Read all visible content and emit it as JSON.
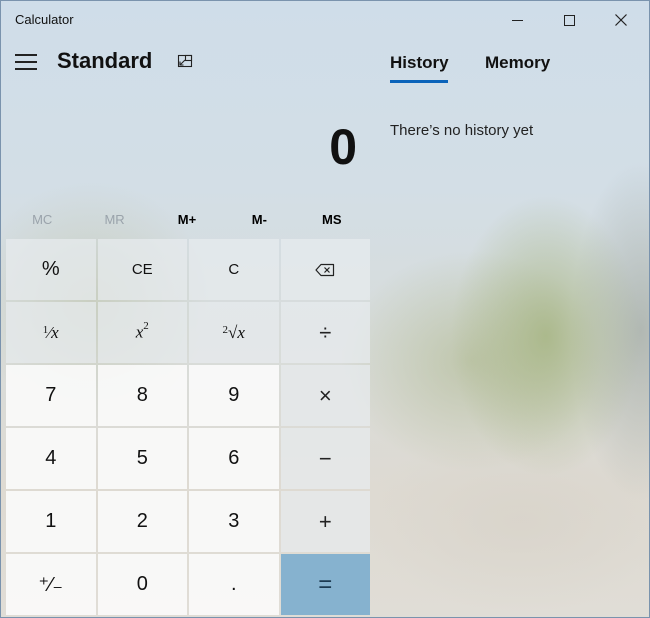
{
  "window": {
    "title": "Calculator"
  },
  "header": {
    "mode_title": "Standard"
  },
  "display": {
    "value": "0"
  },
  "memory_bar": {
    "buttons": [
      {
        "label": "MC",
        "enabled": false
      },
      {
        "label": "MR",
        "enabled": false
      },
      {
        "label": "M+",
        "enabled": true
      },
      {
        "label": "M-",
        "enabled": true
      },
      {
        "label": "MS",
        "enabled": true
      }
    ]
  },
  "keypad": {
    "percent": "%",
    "clear_entry": "CE",
    "clear": "C",
    "backspace_icon": "backspace-icon",
    "reciprocal": "x",
    "square": "x",
    "square_exponent": "2",
    "sqrt": "x",
    "divide": "÷",
    "seven": "7",
    "eight": "8",
    "nine": "9",
    "multiply": "×",
    "four": "4",
    "five": "5",
    "six": "6",
    "minus": "−",
    "one": "1",
    "two": "2",
    "three": "3",
    "plus": "+",
    "negate": "⁺⁄₋",
    "zero": "0",
    "decimal": ".",
    "equals": "="
  },
  "side_panel": {
    "tabs": [
      {
        "label": "History",
        "active": true
      },
      {
        "label": "Memory",
        "active": false
      }
    ],
    "empty_message": "There’s no history yet"
  },
  "colors": {
    "accent": "#0b63ba",
    "equals_key": "#86b2cf"
  }
}
